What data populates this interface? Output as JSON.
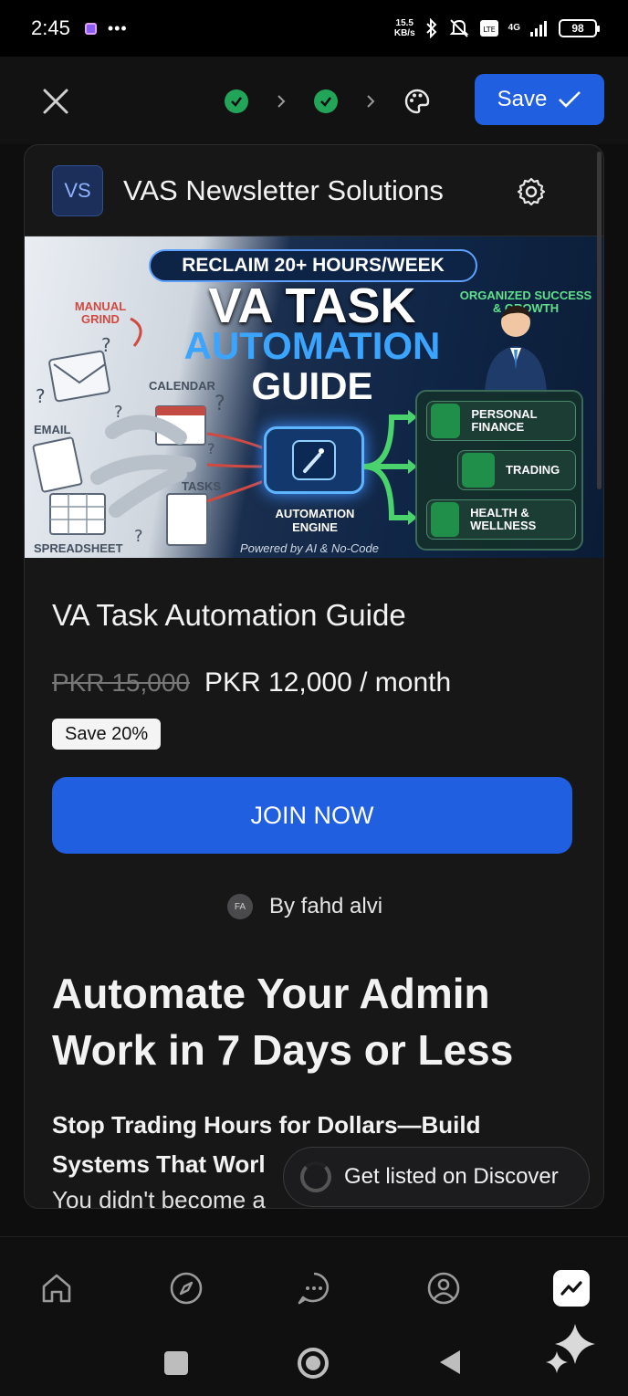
{
  "status_bar": {
    "time": "2:45",
    "dots": "•••",
    "speed_value": "15.5",
    "speed_unit": "KB/s",
    "network": "4G",
    "battery": "98"
  },
  "toolbar": {
    "save_label": "Save"
  },
  "store": {
    "logo_initials": "VS",
    "name": "VAS Newsletter Solutions"
  },
  "banner": {
    "pill": "RECLAIM 20+ HOURS/WEEK",
    "title_line1": "VA TASK",
    "title_line2": "AUTOMATION",
    "title_line3": "GUIDE",
    "label_manual_grind": "MANUAL GRIND",
    "label_email": "EMAIL",
    "label_calendar": "CALENDAR",
    "label_tasks": "TASKS",
    "label_spreadsheet": "SPREADSHEET",
    "label_organized": "ORGANIZED SUCCESS & GROWTH",
    "engine_label": "AUTOMATION ENGINE",
    "powered_by": "Powered by AI & No-Code",
    "panel_items": [
      "PERSONAL FINANCE",
      "TRADING",
      "HEALTH & WELLNESS"
    ]
  },
  "product": {
    "title": "VA Task Automation Guide",
    "old_price": "PKR 15,000",
    "new_price": "PKR 12,000 / month",
    "save_badge": "Save 20%",
    "cta": "JOIN NOW",
    "author_initials": "FA",
    "author": "By fahd alvi",
    "headline": "Automate Your Admin Work in 7 Days or Less",
    "subhead": "Stop Trading Hours for Dollars—Build Systems That Worl",
    "body_snippet": "You didn't become a"
  },
  "toast": {
    "text": "Get listed on Discover"
  },
  "nav": {
    "items": [
      "home-icon",
      "compass-icon",
      "chat-icon",
      "profile-icon",
      "analytics-icon"
    ],
    "active": "analytics-icon"
  },
  "colors": {
    "accent": "#1f5fe0",
    "success": "#22a559",
    "background": "#0e0e0f",
    "card": "#171718"
  }
}
